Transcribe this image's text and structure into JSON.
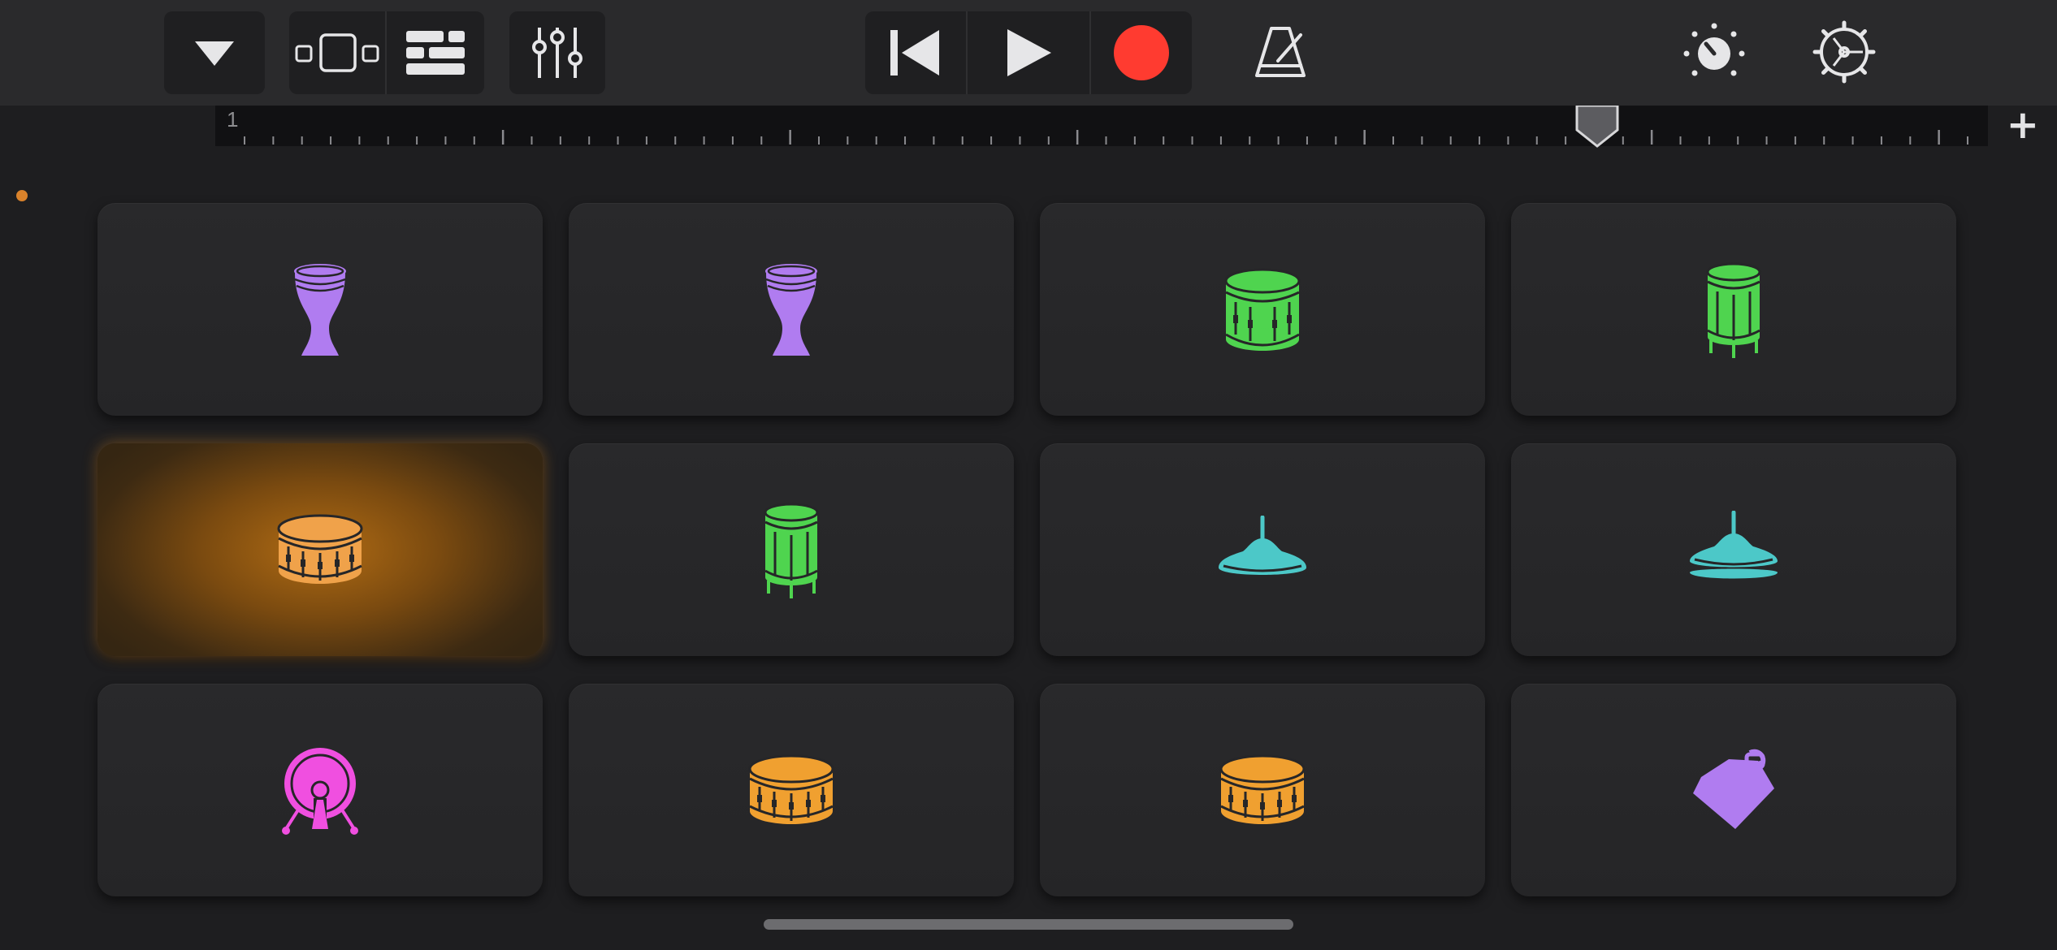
{
  "topbar": {
    "tracks_dropdown_icon": "chevron-down-icon",
    "view_toggle_icons": [
      "single-view-icon",
      "tracks-view-icon"
    ],
    "mixer_icon": "mixer-sliders-icon",
    "transport": [
      "rewind-icon",
      "play-icon",
      "record-icon"
    ],
    "metronome_icon": "metronome-icon",
    "master_icon": "master-effects-knob-icon",
    "settings_icon": "gear-icon",
    "record_color": "#ff3b30"
  },
  "ruler": {
    "bar_number": "1",
    "add_label": "+"
  },
  "pads": [
    {
      "icon": "djembe-icon",
      "color": "#b07cf0"
    },
    {
      "icon": "djembe-icon",
      "color": "#b07cf0"
    },
    {
      "icon": "floor-tom-icon",
      "color": "#4fd44f"
    },
    {
      "icon": "tall-tom-icon",
      "color": "#4fd44f"
    },
    {
      "icon": "snare-drum-icon",
      "color": "#f0a24a",
      "active": true
    },
    {
      "icon": "tall-tom-icon",
      "color": "#4fd44f"
    },
    {
      "icon": "cymbal-icon",
      "color": "#4cc8c8"
    },
    {
      "icon": "hi-hat-icon",
      "color": "#4cc8c8"
    },
    {
      "icon": "kick-drum-icon",
      "color": "#f04fe0"
    },
    {
      "icon": "snare-drum-icon",
      "color": "#f0a030"
    },
    {
      "icon": "snare-drum-icon",
      "color": "#f0a030"
    },
    {
      "icon": "cowbell-icon",
      "color": "#b07cf0"
    }
  ]
}
